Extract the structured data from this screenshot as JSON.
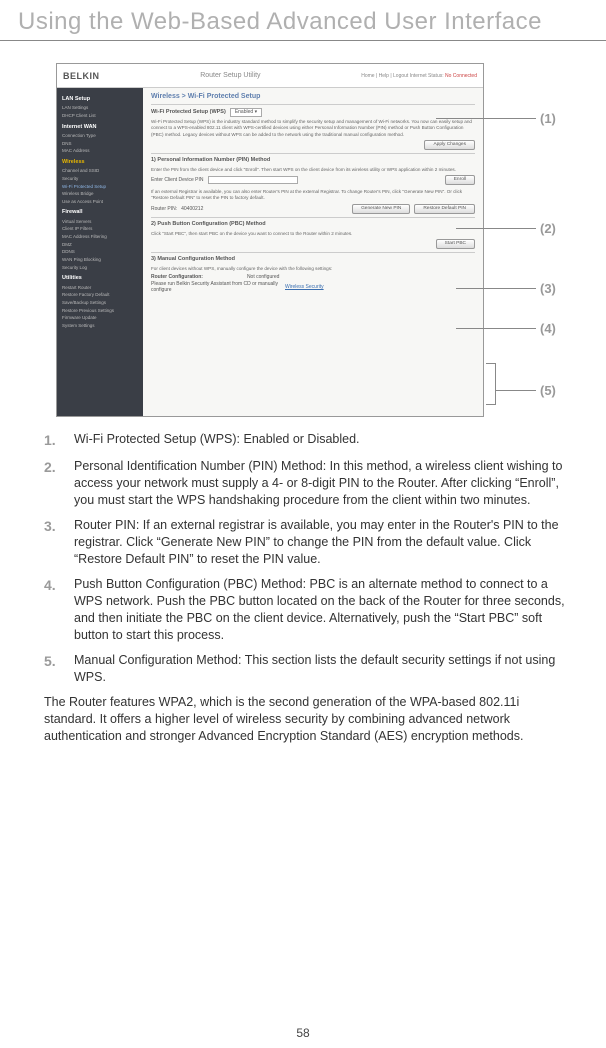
{
  "page": {
    "title": "Using the Web-Based Advanced User Interface",
    "number": "58"
  },
  "shot": {
    "logo": "BELKIN",
    "utility": "Router Setup Utility",
    "topnav": "Home | Help | Logout   Internet Status:",
    "status": "No Connected",
    "breadcrumb": "Wireless > Wi-Fi Protected Setup",
    "wps_label": "Wi-Fi Protected Setup (WPS)",
    "enabled": "Enabled",
    "intro": "Wi-Fi Protected Setup (WPS) is the industry standard method to simplify the security setup and management of Wi-Fi networks. You now can easily setup and connect to a WPS-enabled 802.11 client with WPS-certified devices using either Personal Information Number (PIN) method or Push Button Configuration (PBC) method. Legacy devices without WPS can be added to the network using the traditional manual configuration method.",
    "apply": "Apply Changes",
    "sec1_h": "1) Personal Information Number (PIN) Method",
    "sec1_t": "Enter the PIN from the client device and click \"Enroll\". Then start WPS on the client device from its wireless utility or WPS application within 2 minutes.",
    "pin_lbl": "Enter Client Device PIN",
    "enroll": "Enroll",
    "ext_t": "If an external Registrar is available, you can also enter Router's PIN at the external Registrar. To change Router's PIN, click \"Generate New PIN\". Or click \"Restore Default PIN\" to reset the PIN to factory default.",
    "router_pin_lbl": "Router PIN:",
    "router_pin_val": "40400212",
    "gen": "Generate New PIN",
    "restore": "Restore Default PIN",
    "sec2_h": "2) Push Button Configuration (PBC) Method",
    "sec2_t": "Click \"Start PBC\", then start PBC on the device you want to connect to the Router within 2 minutes.",
    "start_pbc": "Start PBC",
    "sec3_h": "3) Manual Configuration Method",
    "sec3_t": "For client devices without WPS, manually configure the device with the following settings:",
    "rc_lbl": "Router Configuration:",
    "rc_val": "Not configured",
    "rc_hint": "Please run Belkin Security Assistant from CD or manually configure",
    "rc_link": "Wireless Security",
    "sidebar": {
      "lan_h": "LAN Setup",
      "lan1": "LAN Settings",
      "lan2": "DHCP Client List",
      "wan_h": "Internet WAN",
      "wan1": "Connection Type",
      "wan2": "DNS",
      "wan3": "MAC Address",
      "wl_h": "Wireless",
      "wl1": "Channel and SSID",
      "wl2": "Security",
      "wl3": "Wi-Fi Protected Setup",
      "wl4": "Wireless Bridge",
      "wl5": "Use as Access Point",
      "fw_h": "Firewall",
      "fw1": "Virtual Servers",
      "fw2": "Client IP Filters",
      "fw3": "MAC Address Filtering",
      "fw4": "DMZ",
      "fw5": "DDNS",
      "fw6": "WAN Ping Blocking",
      "fw7": "Security Log",
      "ut_h": "Utilities",
      "ut1": "Restart Router",
      "ut2": "Restore Factory Default",
      "ut3": "Save/Backup Settings",
      "ut4": "Restore Previous Settings",
      "ut5": "Firmware Update",
      "ut6": "System Settings"
    }
  },
  "callouts": {
    "c1": "(1)",
    "c2": "(2)",
    "c3": "(3)",
    "c4": "(4)",
    "c5": "(5)"
  },
  "list": {
    "i1n": "1.",
    "i1t": "Wi-Fi Protected Setup (WPS): Enabled or Disabled.",
    "i2n": "2.",
    "i2t": "Personal Identification Number (PIN) Method: In this method, a wireless client wishing to access your network must supply a 4- or 8-digit PIN to the Router. After clicking “Enroll”, you must start the WPS handshaking procedure from the client within two minutes.",
    "i3n": "3.",
    "i3t": "Router PIN: If an external registrar is available, you may enter in the Router's PIN to the registrar. Click “Generate New PIN” to change the PIN from the default value. Click “Restore Default PIN” to reset the PIN value.",
    "i4n": "4.",
    "i4t": "Push Button Configuration (PBC) Method: PBC is an alternate method to connect to a WPS network. Push the PBC button located on the back of the Router for three seconds, and then initiate the PBC on the client device. Alternatively, push the “Start PBC” soft button to start this process.",
    "i5n": "5.",
    "i5t": "Manual Configuration Method: This section lists the default security settings if not using WPS."
  },
  "closing": "The Router features WPA2, which is the second generation of the WPA-based 802.11i standard. It offers a higher level of wireless security by combining advanced network authentication and stronger Advanced Encryption Standard (AES) encryption methods."
}
